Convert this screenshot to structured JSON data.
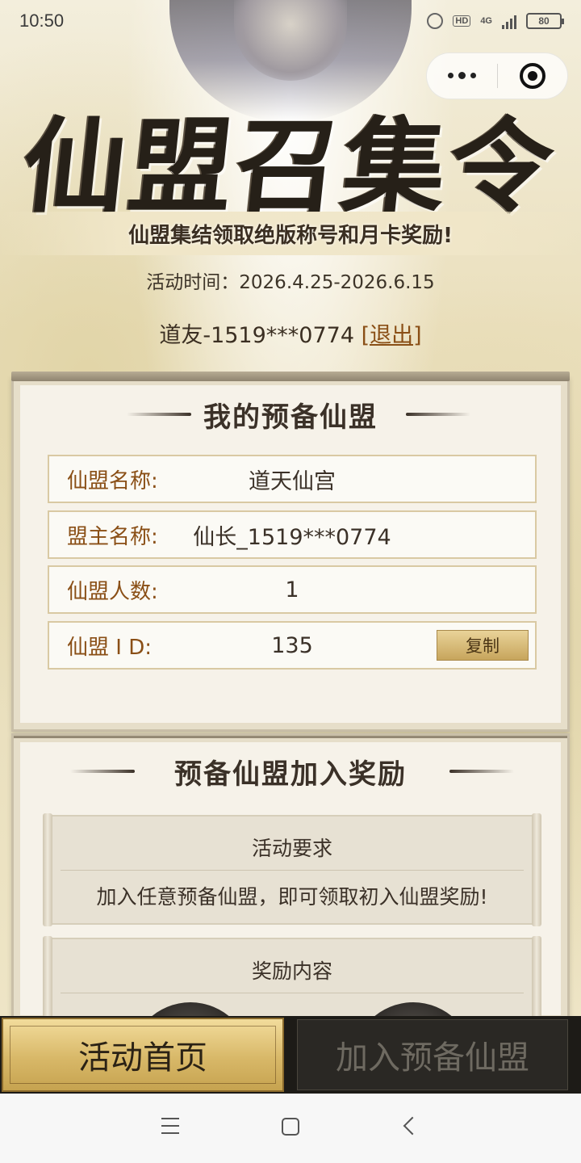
{
  "status_bar": {
    "time": "10:50",
    "network": "4G",
    "hd": "HD",
    "battery": "80"
  },
  "header": {
    "title": "仙盟召集令",
    "subtitle": "仙盟集结领取绝版称号和月卡奖励!",
    "activity_time": "活动时间：2026.4.25-2026.6.15",
    "user_name": "道友-1519***0774",
    "logout_label": "[退出]"
  },
  "my_alliance": {
    "heading": "我的预备仙盟",
    "rows": [
      {
        "label": "仙盟名称:",
        "value": "道天仙宫"
      },
      {
        "label": "盟主名称:",
        "value": "仙长_1519***0774"
      },
      {
        "label": "仙盟人数:",
        "value": "1"
      },
      {
        "label": "仙盟 I D:",
        "value": "135"
      }
    ],
    "copy_label": "复制"
  },
  "join_reward": {
    "heading": "预备仙盟加入奖励",
    "requirement_title": "活动要求",
    "requirement_text": "加入任意预备仙盟，即可领取初入仙盟奖励!",
    "reward_title": "奖励内容"
  },
  "bottom_tabs": {
    "home_label": "活动首页",
    "join_label": "加入预备仙盟"
  },
  "colors": {
    "accent_gold": "#d8b868",
    "label_brown": "#8a4f16",
    "dark_bar": "#1d1b17"
  }
}
